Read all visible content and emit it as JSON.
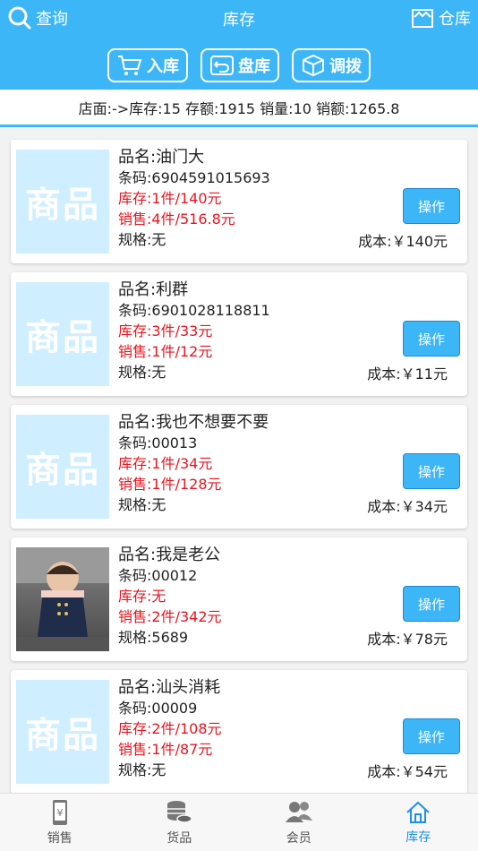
{
  "header": {
    "search_label": "查询",
    "title": "库存",
    "store_label": "仓库"
  },
  "actions": [
    {
      "label": "入库",
      "icon": "cart-icon"
    },
    {
      "label": "盘库",
      "icon": "return-icon"
    },
    {
      "label": "调拨",
      "icon": "box-icon"
    }
  ],
  "summary": "店面:->库存:15 存额:1915 销量:10 销额:1265.8",
  "products": [
    {
      "placeholder": "商品",
      "name": "品名:油门大",
      "barcode": "条码:6904591015693",
      "stock": "库存:1件/140元",
      "sales": "销售:4件/516.8元",
      "spec": "规格:无",
      "cost": "成本:￥140元",
      "op": "操作",
      "photo": false
    },
    {
      "placeholder": "商品",
      "name": "品名:利群",
      "barcode": "条码:6901028118811",
      "stock": "库存:3件/33元",
      "sales": "销售:1件/12元",
      "spec": "规格:无",
      "cost": "成本:￥11元",
      "op": "操作",
      "photo": false
    },
    {
      "placeholder": "商品",
      "name": "品名:我也不想要不要",
      "barcode": "条码:00013",
      "stock": "库存:1件/34元",
      "sales": "销售:1件/128元",
      "spec": "规格:无",
      "cost": "成本:￥34元",
      "op": "操作",
      "photo": false
    },
    {
      "placeholder": "",
      "name": "品名:我是老公",
      "barcode": "条码:00012",
      "stock": "库存:无",
      "sales": "销售:2件/342元",
      "spec": "规格:5689",
      "cost": "成本:￥78元",
      "op": "操作",
      "photo": true
    },
    {
      "placeholder": "商品",
      "name": "品名:汕头消耗",
      "barcode": "条码:00009",
      "stock": "库存:2件/108元",
      "sales": "销售:1件/87元",
      "spec": "规格:无",
      "cost": "成本:￥54元",
      "op": "操作",
      "photo": false
    }
  ],
  "tabs": [
    {
      "label": "销售",
      "icon": "phone-yen-icon"
    },
    {
      "label": "货品",
      "icon": "coins-icon"
    },
    {
      "label": "会员",
      "icon": "users-icon"
    },
    {
      "label": "库存",
      "icon": "home-icon",
      "active": true
    }
  ],
  "colors": {
    "primary": "#3db6f7",
    "red": "#e8141e",
    "active_tab": "#1e90e6"
  }
}
